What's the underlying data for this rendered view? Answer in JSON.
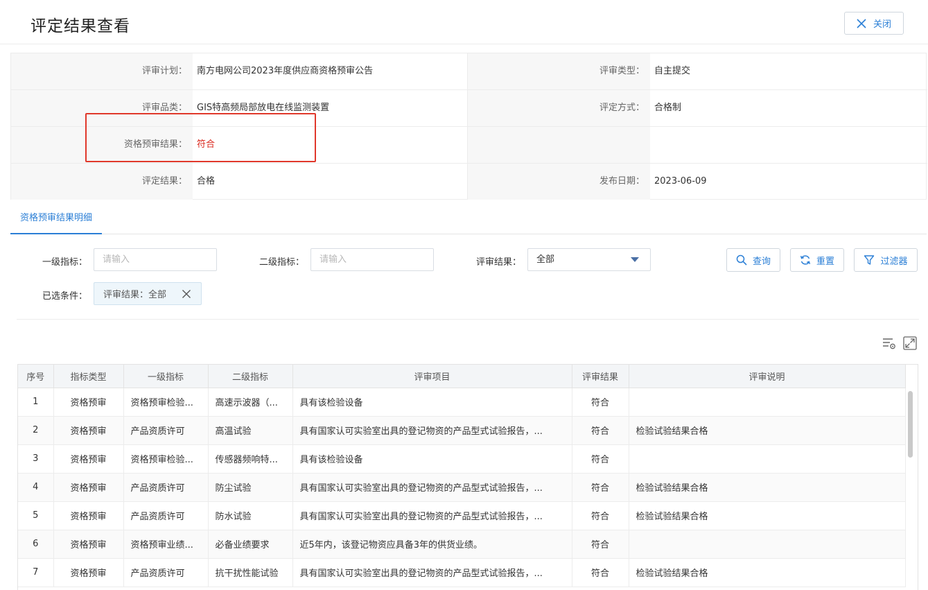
{
  "header": {
    "title": "评定结果查看",
    "close_label": "关闭"
  },
  "info": {
    "rows": [
      {
        "label1": "评审计划：",
        "value1": "南方电网公司2023年度供应商资格预审公告",
        "label2": "评审类型：",
        "value2": "自主提交"
      },
      {
        "label1": "评审品类：",
        "value1": "GIS特高频局部放电在线监测装置",
        "label2": "评定方式：",
        "value2": "合格制"
      },
      {
        "label1": "资格预审结果：",
        "value1": "符合",
        "label2": "",
        "value2": ""
      },
      {
        "label1": "评定结果：",
        "value1": "合格",
        "label2": "发布日期：",
        "value2": "2023-06-09"
      }
    ]
  },
  "tabs": {
    "active": "资格预审结果明细"
  },
  "filters": {
    "level1_label": "一级指标：",
    "level1_placeholder": "请输入",
    "level2_label": "二级指标：",
    "level2_placeholder": "请输入",
    "result_label": "评审结果：",
    "result_value": "全部",
    "query_label": "查询",
    "reset_label": "重置",
    "filter_label": "过滤器",
    "selected_label": "已选条件：",
    "selected_chip": "评审结果：全部"
  },
  "table": {
    "columns": [
      "序号",
      "指标类型",
      "一级指标",
      "二级指标",
      "评审项目",
      "评审结果",
      "评审说明"
    ],
    "rows": [
      [
        "1",
        "资格预审",
        "资格预审检验...",
        "高速示波器（...",
        "具有该检验设备",
        "符合",
        ""
      ],
      [
        "2",
        "资格预审",
        "产品资质许可",
        "高温试验",
        "具有国家认可实验室出具的登记物资的产品型式试验报告，...",
        "符合",
        "检验试验结果合格"
      ],
      [
        "3",
        "资格预审",
        "资格预审检验...",
        "传感器频响特...",
        "具有该检验设备",
        "符合",
        ""
      ],
      [
        "4",
        "资格预审",
        "产品资质许可",
        "防尘试验",
        "具有国家认可实验室出具的登记物资的产品型式试验报告，...",
        "符合",
        "检验试验结果合格"
      ],
      [
        "5",
        "资格预审",
        "产品资质许可",
        "防水试验",
        "具有国家认可实验室出具的登记物资的产品型式试验报告，...",
        "符合",
        "检验试验结果合格"
      ],
      [
        "6",
        "资格预审",
        "资格预审业绩...",
        "必备业绩要求",
        "近5年内，该登记物资应具备3年的供货业绩。",
        "符合",
        ""
      ],
      [
        "7",
        "资格预审",
        "产品资质许可",
        "抗干扰性能试验",
        "具有国家认可实验室出具的登记物资的产品型式试验报告，...",
        "符合",
        "检验试验结果合格"
      ]
    ]
  }
}
